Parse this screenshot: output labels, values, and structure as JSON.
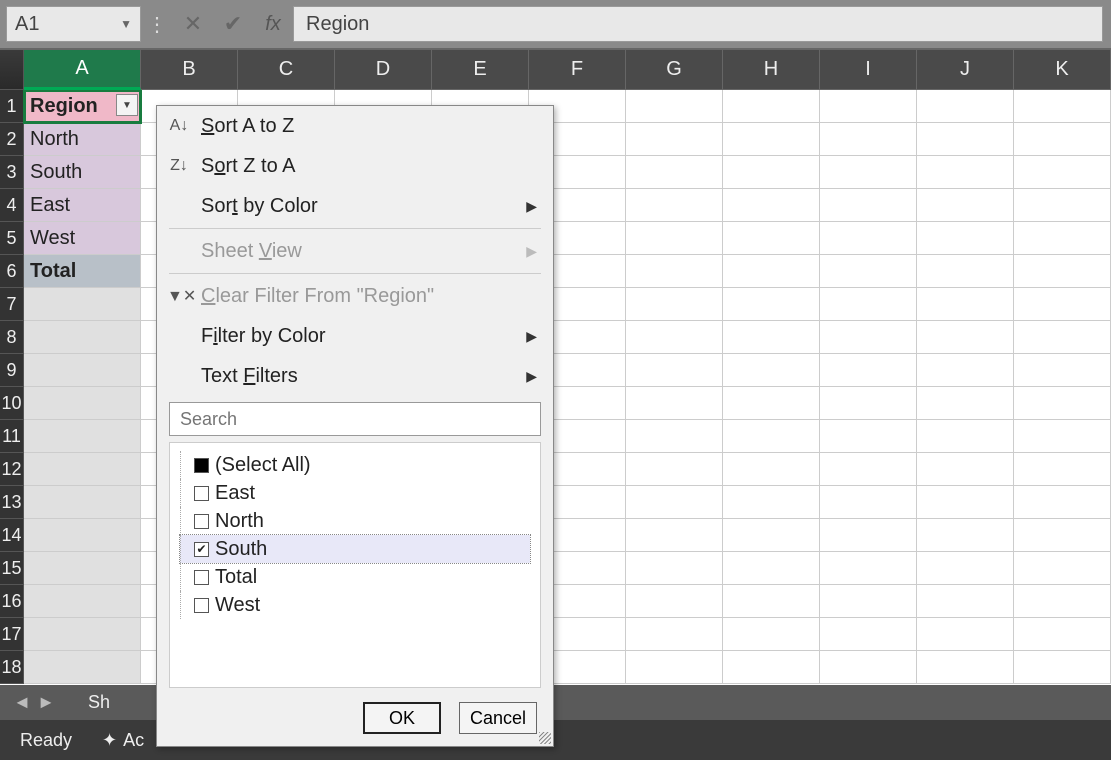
{
  "nameBox": {
    "value": "A1"
  },
  "formula": {
    "value": "Region"
  },
  "columns": [
    "A",
    "B",
    "C",
    "D",
    "E",
    "F",
    "G",
    "H",
    "I",
    "J",
    "K"
  ],
  "selectedColumn": "A",
  "rows": [
    1,
    2,
    3,
    4,
    5,
    6,
    7,
    8,
    9,
    10,
    11,
    12,
    13,
    14,
    15,
    16,
    17,
    18
  ],
  "cellsA": {
    "1": "Region",
    "2": "North",
    "3": "South",
    "4": "East",
    "5": "West",
    "6": "Total"
  },
  "sheetTab": "Sh",
  "statusBar": {
    "ready": "Ready",
    "acc": "Ac"
  },
  "filterMenu": {
    "sortAZ": "Sort A to Z",
    "sortZA": "Sort Z to A",
    "sortByColor": "Sort by Color",
    "sheetView": "Sheet View",
    "clearFilter": "Clear Filter From \"Region\"",
    "filterByColor": "Filter by Color",
    "textFilters": "Text Filters",
    "searchPlaceholder": "Search",
    "items": [
      {
        "label": "(Select All)",
        "state": "mixed"
      },
      {
        "label": "East",
        "state": "unchecked"
      },
      {
        "label": "North",
        "state": "unchecked"
      },
      {
        "label": "South",
        "state": "checked",
        "selected": true
      },
      {
        "label": "Total",
        "state": "unchecked"
      },
      {
        "label": "West",
        "state": "unchecked"
      }
    ],
    "ok": "OK",
    "cancel": "Cancel"
  }
}
